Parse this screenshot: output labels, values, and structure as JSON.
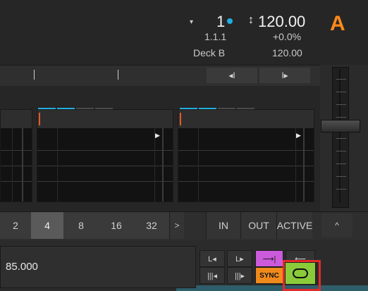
{
  "header": {
    "deck_letter": "A",
    "deck_index": "1",
    "bpm_big": "120.00",
    "position": "1.1.1",
    "pitch_percent": "+0.0%",
    "deck_label": "Deck B",
    "bpm_small": "120.00",
    "accent": "#ff8a1a",
    "sync_dot": "#22aee0"
  },
  "transport": {
    "prev_label": "◂I",
    "next_label": "I▸"
  },
  "loop": {
    "sizes": [
      "2",
      "4",
      "8",
      "16",
      "32"
    ],
    "selected": "4",
    "in_label": "IN",
    "out_label": "OUT",
    "active_label": "ACTIVE",
    "more_label": ">",
    "collapse_label": "^"
  },
  "bottom": {
    "value": "85.000",
    "sync_label": "SYNC",
    "icons": [
      "cue-left-icon",
      "cue-right-icon",
      "arrow-right-icon",
      "arrow-left-icon",
      "beatjump-left-icon",
      "beatjump-right-icon",
      "loop-icon"
    ]
  }
}
